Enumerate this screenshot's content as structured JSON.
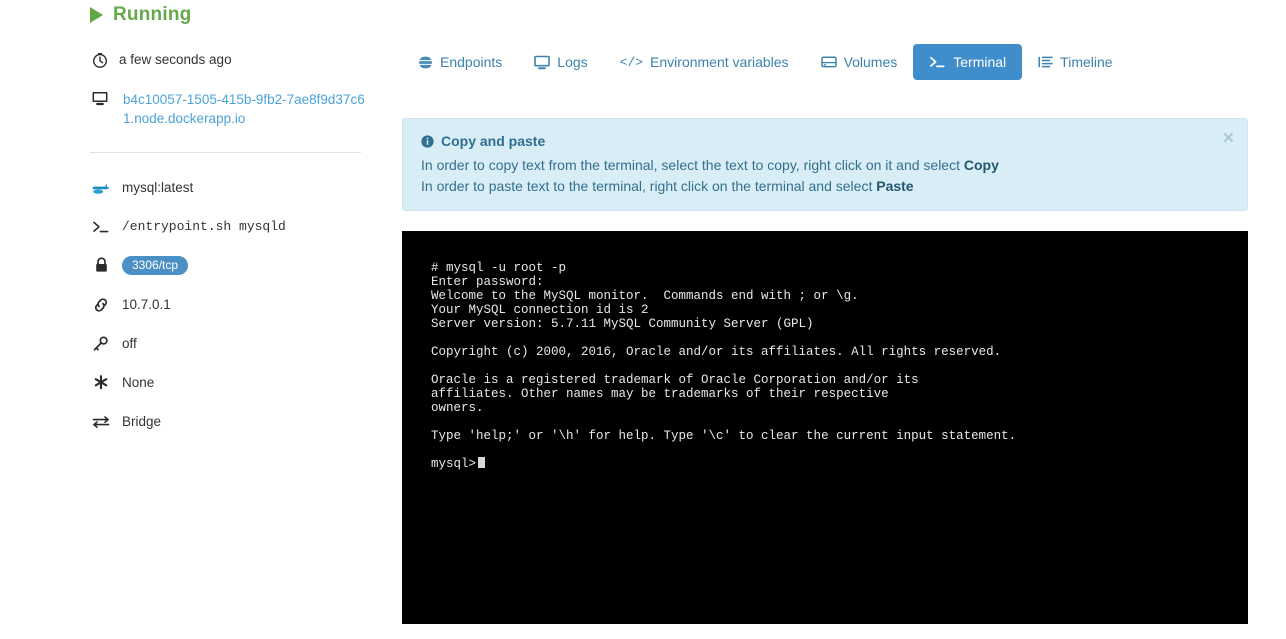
{
  "sidebar": {
    "status": {
      "label": "Running",
      "icon": "play-icon",
      "color": "#65a94a"
    },
    "time": {
      "icon": "clock-icon",
      "label": "a few seconds ago"
    },
    "host": {
      "icon": "monitor-icon",
      "label": "b4c10057-1505-415b-9fb2-7ae8f9d37c61.node.dockerapp.io"
    },
    "info_items": [
      {
        "icon": "docker-whale-icon",
        "label": "mysql:latest",
        "type": "text"
      },
      {
        "icon": "terminal-prompt-icon",
        "label": "/entrypoint.sh mysqld",
        "type": "mono"
      },
      {
        "icon": "lock-icon",
        "label": "3306/tcp",
        "type": "badge"
      },
      {
        "icon": "link-icon",
        "label": "10.7.0.1",
        "type": "text"
      },
      {
        "icon": "key-icon",
        "label": "off",
        "type": "text"
      },
      {
        "icon": "asterisk-icon",
        "label": "None",
        "type": "text"
      },
      {
        "icon": "exchange-icon",
        "label": "Bridge",
        "type": "text"
      }
    ]
  },
  "tabs": [
    {
      "label": "Endpoints",
      "icon": "globe-icon",
      "active": false
    },
    {
      "label": "Logs",
      "icon": "monitor-icon",
      "active": false
    },
    {
      "label": "Environment variables",
      "icon": "code-icon",
      "active": false
    },
    {
      "label": "Volumes",
      "icon": "database-icon",
      "active": false
    },
    {
      "label": "Terminal",
      "icon": "terminal-prompt-icon",
      "active": true
    },
    {
      "label": "Timeline",
      "icon": "list-icon",
      "active": false
    }
  ],
  "alert": {
    "icon": "info-icon",
    "title": "Copy and paste",
    "line1_pre": "In order to copy text from the terminal, select the text to copy, right click on it and select ",
    "line1_bold": "Copy",
    "line2_pre": "In order to paste text to the terminal, right click on the terminal and select ",
    "line2_bold": "Paste",
    "close_label": "×",
    "background": "#d9edf7"
  },
  "terminal": {
    "background": "#000000",
    "foreground": "#e8e8e8",
    "lines": [
      "# mysql -u root -p",
      "Enter password:",
      "Welcome to the MySQL monitor.  Commands end with ; or \\g.",
      "Your MySQL connection id is 2",
      "Server version: 5.7.11 MySQL Community Server (GPL)",
      "",
      "Copyright (c) 2000, 2016, Oracle and/or its affiliates. All rights reserved.",
      "",
      "Oracle is a registered trademark of Oracle Corporation and/or its",
      "affiliates. Other names may be trademarks of their respective",
      "owners.",
      "",
      "Type 'help;' or '\\h' for help. Type '\\c' to clear the current input statement.",
      ""
    ],
    "prompt": "mysql>"
  }
}
